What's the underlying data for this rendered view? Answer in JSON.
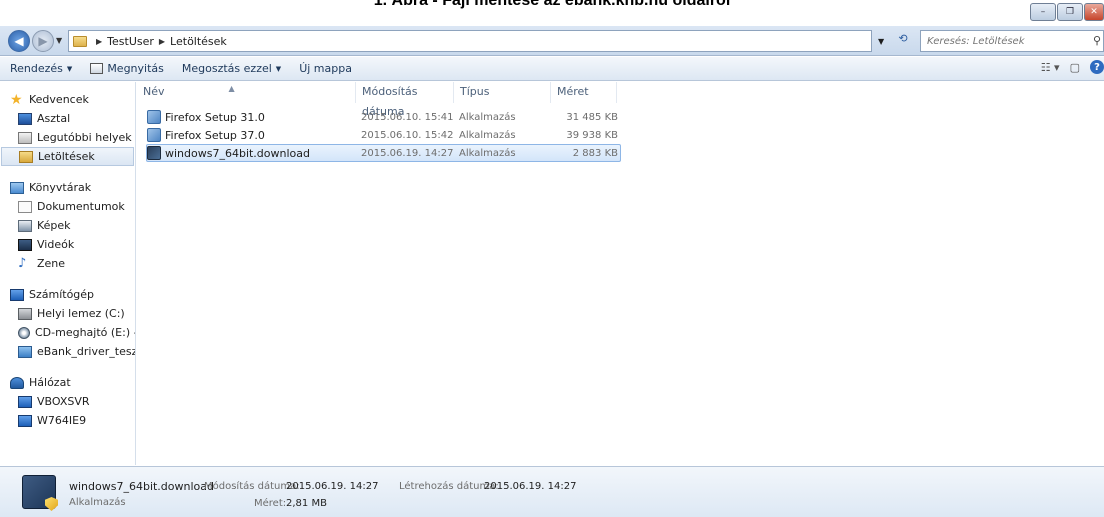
{
  "caption": "1. Ábra - Fájl mentése az ebank.khb.hu oldalról",
  "addressbar": {
    "crumbs": [
      "TestUser",
      "Letöltések"
    ],
    "search_placeholder": "Keresés: Letöltések"
  },
  "toolbar": {
    "organize": "Rendezés",
    "open": "Megnyitás",
    "share": "Megosztás ezzel",
    "new_folder": "Új mappa"
  },
  "sidebar": {
    "favorites": {
      "label": "Kedvencek",
      "items": [
        "Asztal",
        "Legutóbbi helyek",
        "Letöltések"
      ]
    },
    "libraries": {
      "label": "Könyvtárak",
      "items": [
        "Dokumentumok",
        "Képek",
        "Videók",
        "Zene"
      ]
    },
    "computer": {
      "label": "Számítógép",
      "items": [
        "Helyi lemez (C:)",
        "CD-meghajtó (E:) - V",
        "eBank_driver_teszt_e"
      ]
    },
    "network": {
      "label": "Hálózat",
      "items": [
        "VBOXSVR",
        "W764IE9"
      ]
    }
  },
  "columns": {
    "name": "Név",
    "date": "Módosítás dátuma",
    "type": "Típus",
    "size": "Méret"
  },
  "files": [
    {
      "name": "Firefox Setup 31.0",
      "date": "2015.06.10. 15:41",
      "type": "Alkalmazás",
      "size": "31 485 KB"
    },
    {
      "name": "Firefox Setup 37.0",
      "date": "2015.06.10. 15:42",
      "type": "Alkalmazás",
      "size": "39 938 KB"
    },
    {
      "name": "windows7_64bit.download",
      "date": "2015.06.19. 14:27",
      "type": "Alkalmazás",
      "size": "2 883 KB"
    }
  ],
  "details": {
    "name": "windows7_64bit.download",
    "type": "Alkalmazás",
    "modified_label": "Módosítás dátuma:",
    "modified_value": "2015.06.19. 14:27",
    "size_label": "Méret:",
    "size_value": "2,81 MB",
    "created_label": "Létrehozás dátuma:",
    "created_value": "2015.06.19. 14:27"
  }
}
